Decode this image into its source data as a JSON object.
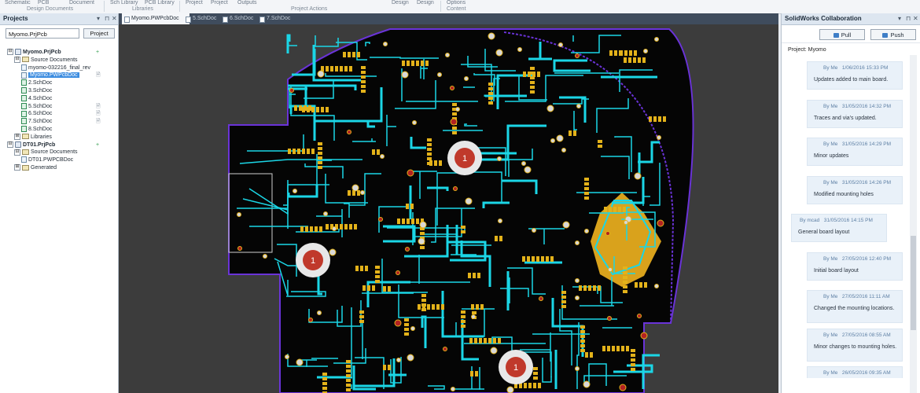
{
  "ribbon": {
    "items": [
      "Schematic",
      "PCB",
      "Document",
      "Sch Library",
      "PCB Library",
      "Project",
      "Project",
      "Outputs",
      "Design",
      "Design",
      "Options"
    ],
    "groups": [
      "Design Documents",
      "Libraries",
      "Project Actions",
      "Content"
    ]
  },
  "projects_panel": {
    "title": "Projects",
    "controls": [
      "▾",
      "⊓",
      "✕"
    ],
    "search_value": "Myomo.PrjPcb",
    "project_button": "Project",
    "tree": [
      {
        "label": "Myomo.PrjPcb",
        "level": 0,
        "type": "proj",
        "expander": "⊟",
        "bold": true,
        "mark": "+"
      },
      {
        "label": "Source Documents",
        "level": 1,
        "type": "folder",
        "expander": "⊟"
      },
      {
        "label": "myomo-032216_final_rev",
        "level": 2,
        "type": "doc"
      },
      {
        "label": "Myomo.PWPcbDoc",
        "level": 2,
        "type": "doc",
        "selected": true,
        "mark": "🗎"
      },
      {
        "label": "2.SchDoc",
        "level": 2,
        "type": "sch"
      },
      {
        "label": "3.SchDoc",
        "level": 2,
        "type": "sch"
      },
      {
        "label": "4.SchDoc",
        "level": 2,
        "type": "sch"
      },
      {
        "label": "5.SchDoc",
        "level": 2,
        "type": "sch",
        "mark": "🗎"
      },
      {
        "label": "6.SchDoc",
        "level": 2,
        "type": "sch",
        "mark": "🗎"
      },
      {
        "label": "7.SchDoc",
        "level": 2,
        "type": "sch",
        "mark": "🗎"
      },
      {
        "label": "8.SchDoc",
        "level": 2,
        "type": "sch"
      },
      {
        "label": "Libraries",
        "level": 1,
        "type": "folder",
        "expander": "⊞"
      },
      {
        "label": "DT01.PrjPcb",
        "level": 0,
        "type": "proj",
        "expander": "⊟",
        "bold": true,
        "mark": "+"
      },
      {
        "label": "Source Documents",
        "level": 1,
        "type": "folder",
        "expander": "⊟"
      },
      {
        "label": "DT01.PWPCBDoc",
        "level": 2,
        "type": "doc"
      },
      {
        "label": "Generated",
        "level": 1,
        "type": "folder",
        "expander": "⊞"
      }
    ]
  },
  "tabs": [
    {
      "label": "Myomo.PWPcbDoc",
      "active": true
    },
    {
      "label": "5.SchDoc",
      "active": false
    },
    {
      "label": "6.SchDoc",
      "active": false
    },
    {
      "label": "7.SchDoc",
      "active": false
    }
  ],
  "pcb": {
    "hole_label": "1",
    "colors": {
      "board": "#050505",
      "outline": "#6a33d8",
      "trace_cyan": "#1bd6e6",
      "pad_yellow": "#e3b21a",
      "copper_pour": "#d9a21c",
      "via_red": "#b22222",
      "background": "#3c3c3c"
    }
  },
  "collab_panel": {
    "title": "SolidWorks Collaboration",
    "controls": [
      "▾",
      "⊓",
      "✕"
    ],
    "pull_label": "Pull",
    "push_label": "Push",
    "project_label": "Project: Myomo",
    "commits": [
      {
        "author": "By Me",
        "date": "1/06/2016 15:33 PM",
        "message": "Updates added to main board.",
        "side": "right"
      },
      {
        "author": "By Me",
        "date": "31/05/2016 14:32 PM",
        "message": "Traces and via's updated.",
        "side": "right"
      },
      {
        "author": "By Me",
        "date": "31/05/2016 14:29 PM",
        "message": "Minor updates",
        "side": "right"
      },
      {
        "author": "By Me",
        "date": "31/05/2016 14:26 PM",
        "message": "Modified mounting holes",
        "side": "right"
      },
      {
        "author": "By mcad",
        "date": "31/05/2016 14:15 PM",
        "message": "General board layout",
        "side": "left"
      },
      {
        "author": "By Me",
        "date": "27/05/2016 12:40 PM",
        "message": "Initial board layout",
        "side": "right"
      },
      {
        "author": "By Me",
        "date": "27/05/2016 11:11 AM",
        "message": "Changed the mounting locations.",
        "side": "right"
      },
      {
        "author": "By Me",
        "date": "27/05/2016 08:55 AM",
        "message": "Minor changes to mounting holes.",
        "side": "right"
      },
      {
        "author": "By Me",
        "date": "26/05/2016 09:35 AM",
        "message": "",
        "side": "right"
      }
    ]
  }
}
